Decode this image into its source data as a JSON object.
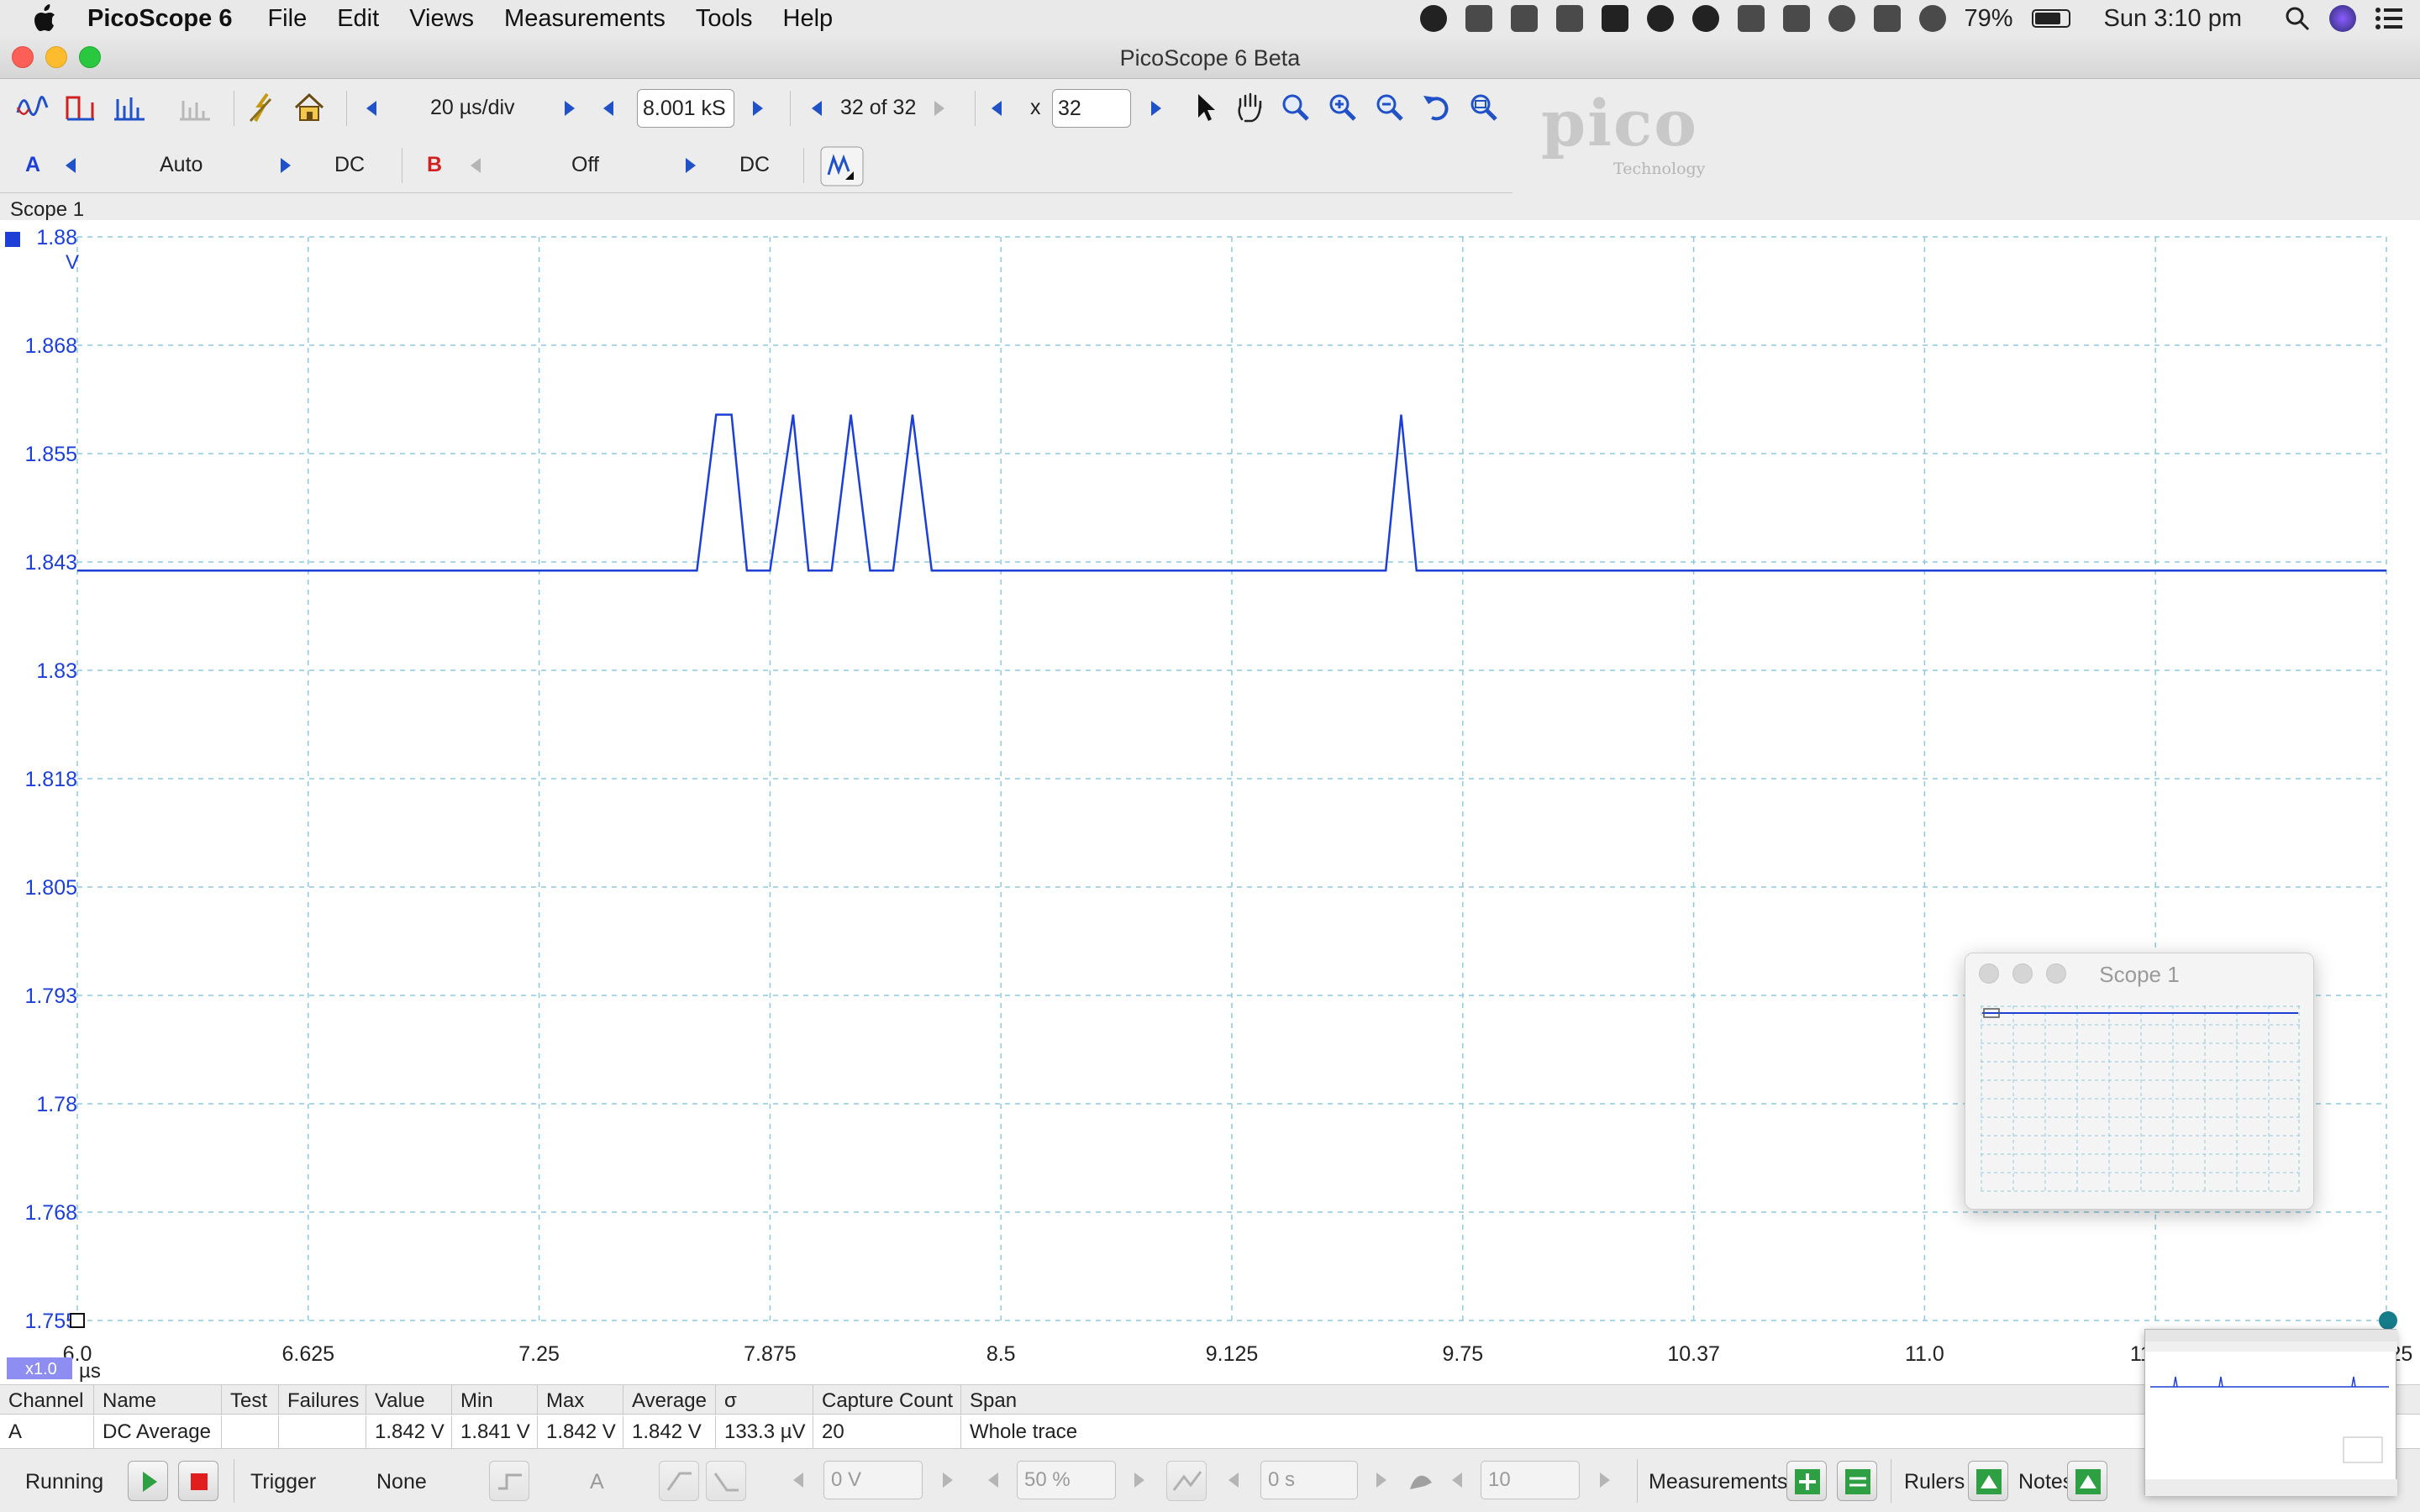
{
  "menubar": {
    "app_name": "PicoScope 6",
    "items": [
      "File",
      "Edit",
      "Views",
      "Measurements",
      "Tools",
      "Help"
    ],
    "battery": "79%",
    "clock": "Sun 3:10 pm"
  },
  "window": {
    "title": "PicoScope 6 Beta"
  },
  "toolbar1": {
    "timebase": "20 µs/div",
    "samples": "8.001 kS",
    "buffer": "32 of 32",
    "zoom_prefix": "x",
    "zoom_value": "32"
  },
  "toolbar2": {
    "channel_a": {
      "label": "A",
      "range": "Auto",
      "coupling": "DC",
      "color": "#1d3fd6"
    },
    "channel_b": {
      "label": "B",
      "range": "Off",
      "coupling": "DC",
      "color": "#d02020"
    }
  },
  "logo": {
    "text": "pico",
    "sub": "Technology"
  },
  "scope": {
    "tab": "Scope 1",
    "x_unit": "µs",
    "y_unit": "V",
    "zoom_badge": "x1.0"
  },
  "chart_data": {
    "type": "line",
    "ylabel": "V",
    "xlabel": "µs",
    "ylim": [
      1.755,
      1.88
    ],
    "xlim": [
      6.0,
      12.0
    ],
    "yticks": [
      "1.88",
      "1.868",
      "1.855",
      "1.843",
      "1.83",
      "1.818",
      "1.805",
      "1.793",
      "1.78",
      "1.768",
      "1.755"
    ],
    "xticks": [
      "6.0",
      "6.625",
      "7.25",
      "7.875",
      "8.5",
      "9.125",
      "9.75",
      "10.37",
      "11.0",
      "11.62",
      "12.25"
    ],
    "grid": true,
    "series": [
      {
        "color": "#1d3fd6",
        "x": [
          6.0,
          7.61,
          7.66,
          7.7,
          7.74,
          7.8,
          7.86,
          7.9,
          7.96,
          8.01,
          8.06,
          8.12,
          8.17,
          8.22,
          9.4,
          9.44,
          9.48,
          12.0
        ],
        "y": [
          1.8415,
          1.8415,
          1.8595,
          1.8595,
          1.8415,
          1.8415,
          1.8595,
          1.8415,
          1.8415,
          1.8595,
          1.8415,
          1.8415,
          1.8595,
          1.8415,
          1.8415,
          1.8595,
          1.8415,
          1.8415
        ]
      }
    ]
  },
  "measurements": {
    "headers": [
      "Channel",
      "Name",
      "Test",
      "Failures",
      "Value",
      "Min",
      "Max",
      "Average",
      "σ",
      "Capture Count",
      "Span"
    ],
    "row": [
      "A",
      "DC Average",
      "",
      "",
      "1.842 V",
      "1.841 V",
      "1.842 V",
      "1.842 V",
      "133.3 µV",
      "20",
      "Whole trace"
    ]
  },
  "status": {
    "run_state": "Running",
    "trigger_label": "Trigger",
    "trigger_mode": "None",
    "trigger_channel": "A",
    "threshold": "0 V",
    "pretrigger": "50 %",
    "delay": "0 s",
    "captures": "10",
    "measurements_label": "Measurements",
    "rulers_label": "Rulers",
    "notes_label": "Notes"
  },
  "mini_window": {
    "title": "Scope 1"
  }
}
